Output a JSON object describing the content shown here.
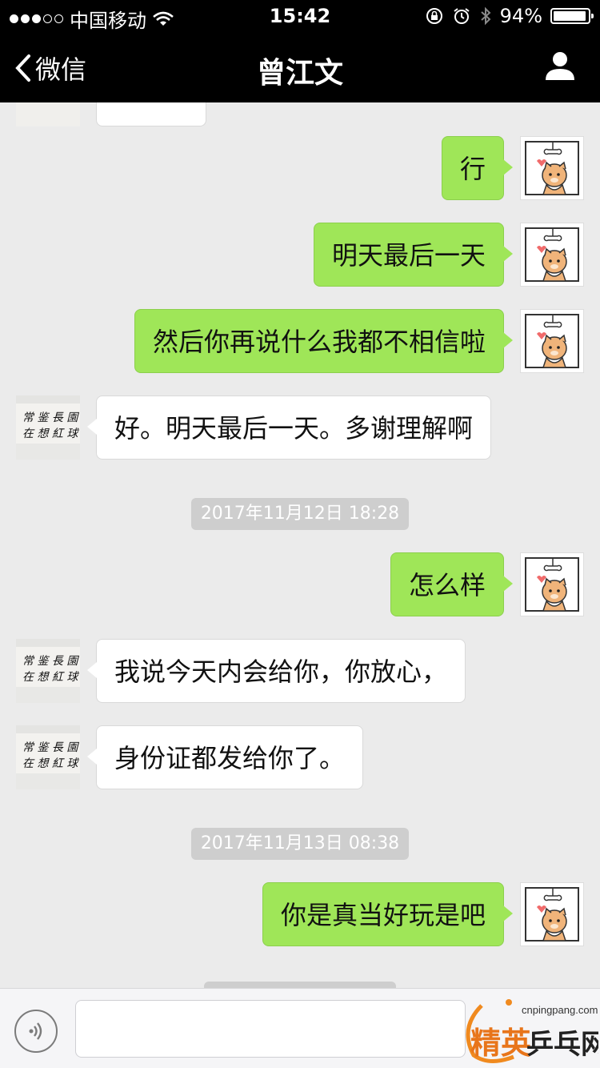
{
  "status_bar": {
    "carrier": "中国移动",
    "time": "15:42",
    "battery": "94%",
    "battery_level": 0.94
  },
  "nav": {
    "back_label": "微信",
    "title": "曾江文"
  },
  "messages": [
    {
      "side": "me",
      "text": "行"
    },
    {
      "side": "me",
      "text": "明天最后一天"
    },
    {
      "side": "me",
      "text": "然后你再说什么我都不相信啦"
    },
    {
      "side": "other",
      "text": "好。明天最后一天。多谢理解啊"
    },
    {
      "type": "time",
      "text": "2017年11月12日 18:28"
    },
    {
      "side": "me",
      "text": "怎么样"
    },
    {
      "side": "other",
      "text": "我说今天内会给你，你放心，"
    },
    {
      "side": "other",
      "text": "身份证都发给你了。"
    },
    {
      "type": "time",
      "text": "2017年11月13日 08:38"
    },
    {
      "side": "me",
      "text": "你是真当好玩是吧"
    }
  ],
  "avatars": {
    "other_calligraphy": [
      "常",
      "鉴",
      "长",
      "园",
      "在",
      "想",
      "红",
      "球"
    ]
  },
  "watermark": {
    "site": "cnpingpang.com",
    "brand": "精英乒乓网"
  },
  "colors": {
    "my_bubble": "#9fe658",
    "other_bubble": "#ffffff",
    "background": "#ebebeb",
    "bar": "#000000"
  }
}
